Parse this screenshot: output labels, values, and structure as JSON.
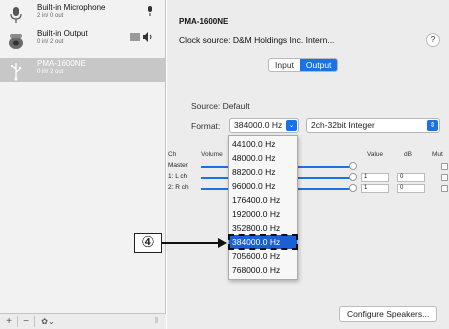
{
  "sidebar": {
    "devices": [
      {
        "name": "Built-in Microphone",
        "sub": "2 in/ 0 out",
        "icon": "microphone-icon",
        "right_icon": "mic-indicator-icon"
      },
      {
        "name": "Built-in Output",
        "sub": "0 in/ 2 out",
        "icon": "speaker-icon",
        "right_icon": "volume-indicator-icon"
      },
      {
        "name": "PMA-1600NE",
        "sub": "0 in/ 2 out",
        "icon": "usb-icon"
      }
    ],
    "bottom": {
      "add": "+",
      "remove": "−",
      "gear": "✿⌄",
      "grip": "⦀"
    }
  },
  "main": {
    "device_title": "PMA-1600NE",
    "clock_source": "Clock source: D&M Holdings Inc. Intern...",
    "help": "?",
    "tabs": [
      "Input",
      "Output"
    ],
    "active_tab": "Output",
    "source": "Source:  Default",
    "format_label": "Format:",
    "format_value": "384000.0 Hz",
    "format_bits": "2ch-32bit Integer",
    "table_headers": {
      "ch": "Ch",
      "volume": "Volume",
      "value": "Value",
      "db": "dB",
      "mute": "Mut"
    },
    "rows": [
      {
        "ch": "Master",
        "value": "",
        "db": ""
      },
      {
        "ch": "1: L ch",
        "value": "1",
        "db": "0"
      },
      {
        "ch": "2: R ch",
        "value": "1",
        "db": "0"
      }
    ],
    "configure_button": "Configure Speakers..."
  },
  "dropdown": {
    "options": [
      "44100.0 Hz",
      "48000.0 Hz",
      "88200.0 Hz",
      "96000.0 Hz",
      "176400.0 Hz",
      "192000.0 Hz",
      "352800.0 Hz",
      "384000.0 Hz",
      "705600.0 Hz",
      "768000.0 Hz"
    ],
    "selected": "384000.0 Hz"
  },
  "callout": {
    "label": "④"
  },
  "colors": {
    "accent": "#1a72e8",
    "highlight": "#1a5fd6",
    "sidebar_selected": "#c7c7c7"
  }
}
